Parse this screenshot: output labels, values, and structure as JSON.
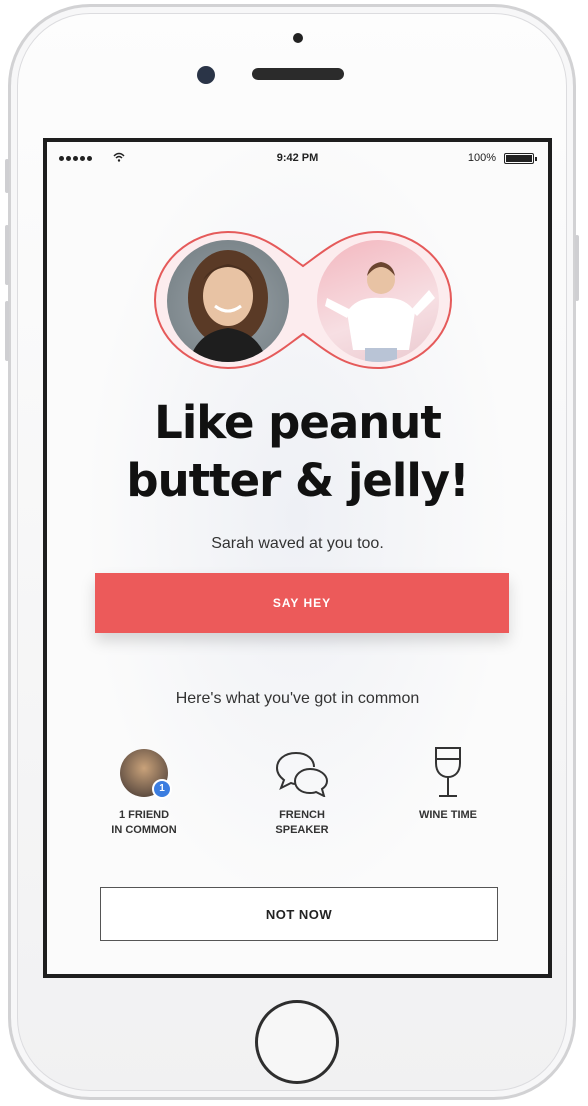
{
  "status_bar": {
    "time": "9:42 PM",
    "battery_percent": "100%"
  },
  "match": {
    "headline_line1": "Like peanut",
    "headline_line2": "butter & jelly!",
    "subtext": "Sarah waved at you too.",
    "say_hey_label": "SAY HEY",
    "common_title": "Here's what you've got in common",
    "common_items": [
      {
        "icon": "friend-avatar-icon",
        "label_line1": "1 FRIEND",
        "label_line2": "IN COMMON",
        "badge": "1"
      },
      {
        "icon": "speech-bubbles-icon",
        "label_line1": "FRENCH",
        "label_line2": "SPEAKER"
      },
      {
        "icon": "wine-glass-icon",
        "label_line1": "WINE TIME",
        "label_line2": ""
      }
    ],
    "not_now_label": "NOT NOW"
  },
  "colors": {
    "accent": "#ec5a5a",
    "ring": "#e55a5a"
  }
}
